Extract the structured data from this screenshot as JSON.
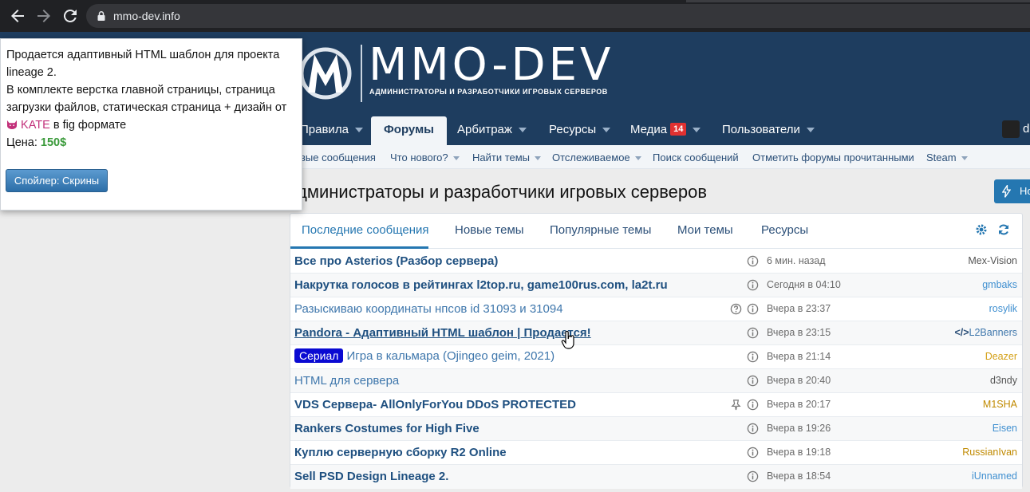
{
  "browser": {
    "url": "mmo-dev.info"
  },
  "site": {
    "logo_text": "MMO-DEV",
    "logo_sub": "АДМИНИСТРАТОРЫ И РАЗРАБОТЧИКИ ИГРОВЫХ СЕРВЕРОВ"
  },
  "primary_nav": {
    "items": [
      {
        "label": "Правила"
      },
      {
        "label": "Форумы"
      },
      {
        "label": "Арбитраж"
      },
      {
        "label": "Ресурсы"
      },
      {
        "label": "Медиа",
        "badge": "14"
      },
      {
        "label": "Пользователи"
      }
    ],
    "avatar_letter": "d"
  },
  "sub_nav": {
    "items": [
      {
        "label": "вые сообщения"
      },
      {
        "label": "Что нового?"
      },
      {
        "label": "Найти темы"
      },
      {
        "label": "Отслеживаемое"
      },
      {
        "label": "Поиск сообщений"
      },
      {
        "label": "Отметить форумы прочитанными"
      },
      {
        "label": "Steam"
      }
    ]
  },
  "page": {
    "title": "дминистраторы и разработчики игровых серверов",
    "new_button": "Но"
  },
  "tabs": [
    {
      "label": "Последние сообщения"
    },
    {
      "label": "Новые темы"
    },
    {
      "label": "Популярные темы"
    },
    {
      "label": "Мои темы"
    },
    {
      "label": "Ресурсы"
    }
  ],
  "threads": [
    {
      "title": "Все про Asterios (Разбор сервера)",
      "time": "6 мин. назад",
      "user": "Mex-Vision",
      "user_color": "#555555"
    },
    {
      "title": "Накрутка голосов в рейтингах l2top.ru, game100rus.com, la2t.ru",
      "time": "Сегодня в 04:10",
      "user": "gmbaks",
      "user_color": "#3f8fd0"
    },
    {
      "title": "Разыскиваю координаты нпсов id 31093 и 31094",
      "time": "Вчера в 23:37",
      "user": "rosylik",
      "user_color": "#3f8fd0"
    },
    {
      "title": "Pandora - Адаптивный HTML шаблон | Продается!",
      "time": "Вчера в 23:15",
      "user": "L2Banners",
      "user_color": "#3f77ac"
    },
    {
      "prefix": "Сериал",
      "title": "Игра в кальмара (Ojingeo geim, 2021)",
      "time": "Вчера в 21:14",
      "user": "Deazer",
      "user_color": "#d4a017"
    },
    {
      "title": "HTML для сервера",
      "time": "Вчера в 20:40",
      "user": "d3ndy",
      "user_color": "#555555"
    },
    {
      "title": "VDS Сервера- AllOnlyForYou DDoS PROTECTED",
      "time": "Вчера в 20:17",
      "user": "M1SHA",
      "user_color": "#c08a00"
    },
    {
      "title": "Rankers Costumes for High Five",
      "time": "Вчера в 19:26",
      "user": "Eisen",
      "user_color": "#3f8fd0"
    },
    {
      "title": "Куплю серверную сборку R2 Online",
      "time": "Вчера в 19:18",
      "user": "RussianIvan",
      "user_color": "#c08a00"
    },
    {
      "title": "Sell PSD Design Lineage 2.",
      "time": "Вчера в 18:54",
      "user": "iUnnamed",
      "user_color": "#3f8fd0"
    }
  ],
  "popup": {
    "line1": "Продается адаптивный HTML шаблон для проекта",
    "line2": "lineage 2.",
    "line3": "В комплекте верстка главной страницы, страница",
    "line4": "загрузки файлов, статическая страница + дизайн от",
    "kate": "KATE",
    "line5_rest": " в fig формате",
    "price_label": "Цена: ",
    "price": "150$",
    "spoiler_button": "Спойлер: Скрины"
  }
}
